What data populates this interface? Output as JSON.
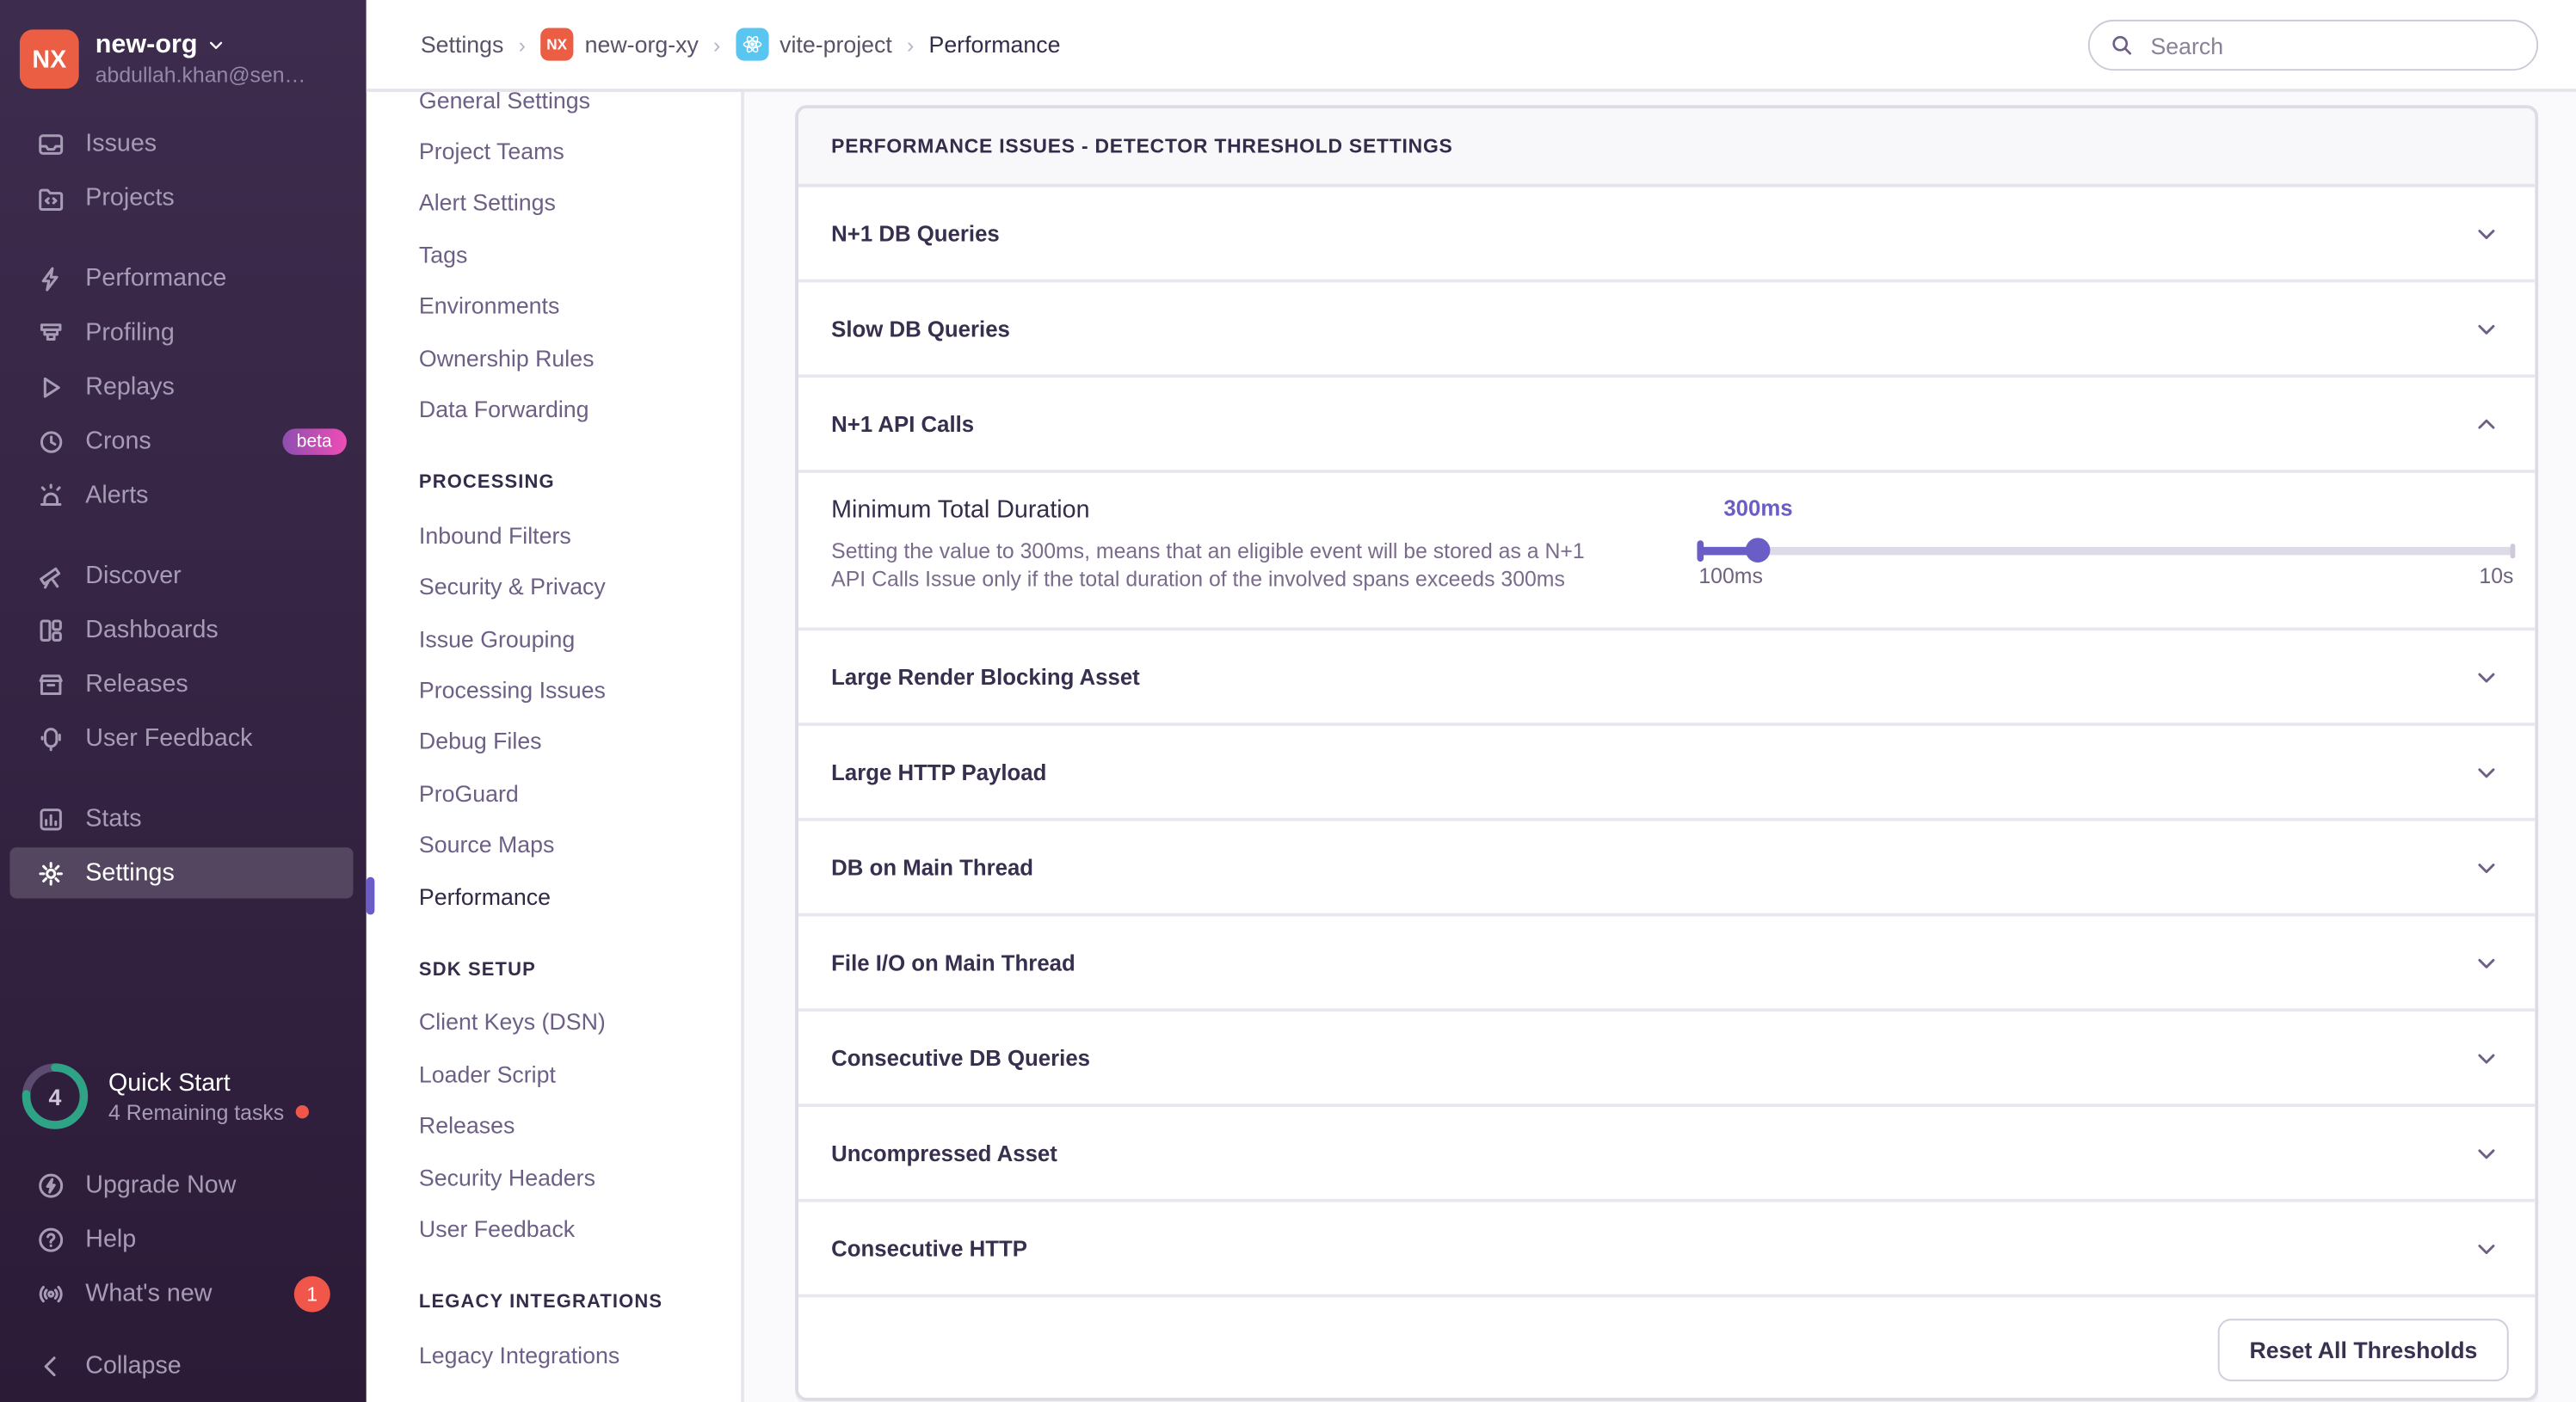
{
  "colors": {
    "accent_purple": "#6a5dc6",
    "org_avatar_red": "#ec5e44",
    "badge_red": "#f0564a",
    "beta_gradient": [
      "#8d4eb0",
      "#ef4db6"
    ],
    "progress_teal": "#2fa385",
    "react_blue": "#58c6f0"
  },
  "org": {
    "avatar_initials": "NX",
    "name": "new-org",
    "email": "abdullah.khan@sen…"
  },
  "sidebar": {
    "groups": [
      {
        "items": [
          {
            "label": "Issues",
            "icon": "issues-icon"
          },
          {
            "label": "Projects",
            "icon": "projects-icon"
          }
        ]
      },
      {
        "items": [
          {
            "label": "Performance",
            "icon": "performance-icon"
          },
          {
            "label": "Profiling",
            "icon": "profiling-icon"
          },
          {
            "label": "Replays",
            "icon": "replays-icon"
          },
          {
            "label": "Crons",
            "icon": "crons-icon",
            "beta": "beta"
          },
          {
            "label": "Alerts",
            "icon": "alerts-icon"
          }
        ]
      },
      {
        "items": [
          {
            "label": "Discover",
            "icon": "discover-icon"
          },
          {
            "label": "Dashboards",
            "icon": "dashboards-icon"
          },
          {
            "label": "Releases",
            "icon": "releases-icon"
          },
          {
            "label": "User Feedback",
            "icon": "user-feedback-icon"
          }
        ]
      },
      {
        "items": [
          {
            "label": "Stats",
            "icon": "stats-icon"
          },
          {
            "label": "Settings",
            "icon": "settings-icon",
            "active": true
          }
        ]
      }
    ],
    "quickstart": {
      "count": "4",
      "title": "Quick Start",
      "subtitle": "4 Remaining tasks",
      "progress_pct": 76
    },
    "bottom": [
      {
        "label": "Upgrade Now",
        "icon": "upgrade-icon"
      },
      {
        "label": "Help",
        "icon": "help-icon"
      },
      {
        "label": "What's new",
        "icon": "whats-new-icon",
        "badge": "1"
      }
    ],
    "collapse": {
      "label": "Collapse",
      "icon": "collapse-icon"
    }
  },
  "header": {
    "breadcrumbs": [
      {
        "label": "Settings"
      },
      {
        "label": "new-org-xy",
        "badge": "NX",
        "badge_type": "nx"
      },
      {
        "label": "vite-project",
        "badge": "react",
        "badge_type": "react"
      },
      {
        "label": "Performance",
        "current": true
      }
    ],
    "search_placeholder": "Search"
  },
  "subnav": {
    "groups": [
      {
        "header": "",
        "items": [
          "General Settings",
          "Project Teams",
          "Alert Settings",
          "Tags",
          "Environments",
          "Ownership Rules",
          "Data Forwarding"
        ]
      },
      {
        "header": "PROCESSING",
        "items": [
          "Inbound Filters",
          "Security & Privacy",
          "Issue Grouping",
          "Processing Issues",
          "Debug Files",
          "ProGuard",
          "Source Maps",
          "Performance"
        ]
      },
      {
        "header": "SDK SETUP",
        "items": [
          "Client Keys (DSN)",
          "Loader Script",
          "Releases",
          "Security Headers",
          "User Feedback"
        ]
      },
      {
        "header": "LEGACY INTEGRATIONS",
        "items": [
          "Legacy Integrations"
        ]
      }
    ],
    "active_item": "Performance"
  },
  "panel": {
    "title": "PERFORMANCE ISSUES - DETECTOR THRESHOLD SETTINGS",
    "rows": [
      {
        "label": "N+1 DB Queries",
        "expanded": false
      },
      {
        "label": "Slow DB Queries",
        "expanded": false
      },
      {
        "label": "N+1 API Calls",
        "expanded": true,
        "detail": {
          "setting_label": "Minimum Total Duration",
          "description": "Setting the value to 300ms, means that an eligible event will be stored as a N+1 API Calls Issue only if the total duration of the involved spans exceeds 300ms",
          "slider": {
            "value_label": "300ms",
            "min_label": "100ms",
            "max_label": "10s",
            "position_pct": 7.3
          }
        }
      },
      {
        "label": "Large Render Blocking Asset",
        "expanded": false
      },
      {
        "label": "Large HTTP Payload",
        "expanded": false
      },
      {
        "label": "DB on Main Thread",
        "expanded": false
      },
      {
        "label": "File I/O on Main Thread",
        "expanded": false
      },
      {
        "label": "Consecutive DB Queries",
        "expanded": false
      },
      {
        "label": "Uncompressed Asset",
        "expanded": false
      },
      {
        "label": "Consecutive HTTP",
        "expanded": false
      }
    ],
    "footer_button": "Reset All Thresholds"
  }
}
